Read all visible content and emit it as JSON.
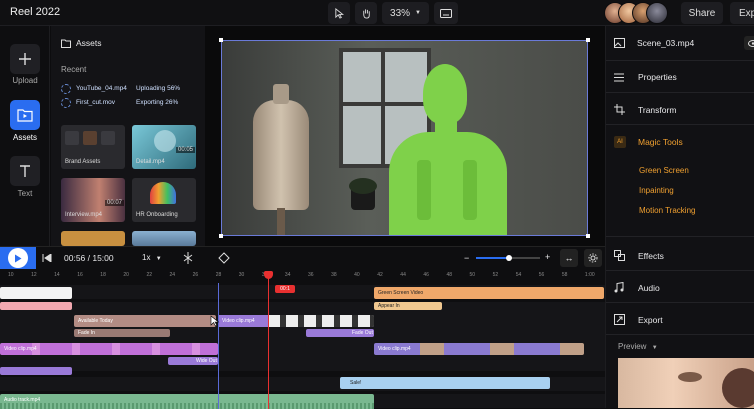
{
  "app": {
    "title": "Reel 2022",
    "zoom": "33%",
    "share": "Share",
    "export_btn": "Exp"
  },
  "rail": {
    "upload": "Upload",
    "assets": "Assets",
    "text": "Text"
  },
  "assets": {
    "header": "Assets",
    "recent": "Recent",
    "uploads": [
      {
        "name": "YouTube_04.mp4",
        "status": "Uploading 56%",
        "progress": 0.56
      },
      {
        "name": "First_cut.mov",
        "status": "Exporting 26%",
        "progress": 0.26
      }
    ],
    "items": [
      {
        "label": "Brand Assets"
      },
      {
        "label": "Detail.mp4",
        "duration": "00:05"
      },
      {
        "label": "Interview.mp4",
        "duration": "00:07"
      },
      {
        "label": "HR Onboarding"
      }
    ]
  },
  "right": {
    "file": "Scene_03.mp4",
    "properties": "Properties",
    "transform": "Transform",
    "magic": "Magic Tools",
    "ai": "AI",
    "tools": [
      "Green Screen",
      "Inpainting",
      "Motion Tracking"
    ],
    "effects": "Effects",
    "audio": "Audio",
    "export": "Export",
    "preview": "Preview"
  },
  "timeline": {
    "time": "00:56 / 15:00",
    "speed": "1x",
    "marker": "00:1",
    "ticks": [
      "10",
      "12",
      "14",
      "16",
      "18",
      "20",
      "22",
      "24",
      "26",
      "28",
      "30",
      "32",
      "34",
      "36",
      "38",
      "40",
      "42",
      "44",
      "46",
      "48",
      "50",
      "52",
      "54",
      "56",
      "58",
      "1:00"
    ],
    "clips": {
      "greenscreen": "Green Screen Video",
      "appear": "Appear In",
      "available": "Available Today",
      "facein": "Fade In",
      "fadeout": "Fade Out",
      "video1": "Video clip.mp4",
      "video2": "Video clip.mp4",
      "video3": "Video clip.mp4",
      "wideout": "Wide Out",
      "sale": "Sale!",
      "audio": "Audio track.mp4"
    }
  },
  "colors": {
    "accent": "#2a6df0",
    "magic": "#f0a030",
    "green": "#7fd14a"
  }
}
